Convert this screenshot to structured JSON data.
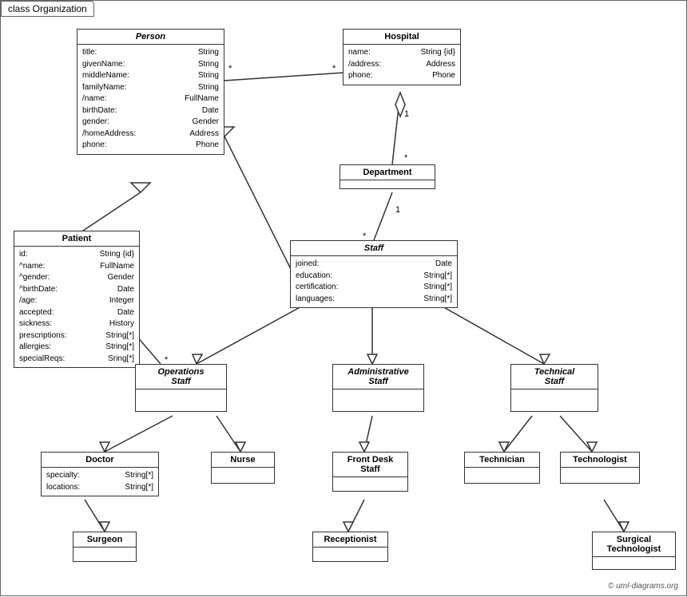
{
  "title": "class Organization",
  "classes": {
    "person": {
      "name": "Person",
      "italic": true,
      "attrs": [
        {
          "name": "title:",
          "type": "String"
        },
        {
          "name": "givenName:",
          "type": "String"
        },
        {
          "name": "middleName:",
          "type": "String"
        },
        {
          "name": "familyName:",
          "type": "String"
        },
        {
          "name": "/name:",
          "type": "FullName"
        },
        {
          "name": "birthDate:",
          "type": "Date"
        },
        {
          "name": "gender:",
          "type": "Gender"
        },
        {
          "name": "/homeAddress:",
          "type": "Address"
        },
        {
          "name": "phone:",
          "type": "Phone"
        }
      ]
    },
    "hospital": {
      "name": "Hospital",
      "italic": false,
      "attrs": [
        {
          "name": "name:",
          "type": "String {id}"
        },
        {
          "name": "/address:",
          "type": "Address"
        },
        {
          "name": "phone:",
          "type": "Phone"
        }
      ]
    },
    "department": {
      "name": "Department",
      "italic": false,
      "attrs": []
    },
    "staff": {
      "name": "Staff",
      "italic": true,
      "attrs": [
        {
          "name": "joined:",
          "type": "Date"
        },
        {
          "name": "education:",
          "type": "String[*]"
        },
        {
          "name": "certification:",
          "type": "String[*]"
        },
        {
          "name": "languages:",
          "type": "String[*]"
        }
      ]
    },
    "patient": {
      "name": "Patient",
      "italic": false,
      "attrs": [
        {
          "name": "id:",
          "type": "String {id}"
        },
        {
          "name": "^name:",
          "type": "FullName"
        },
        {
          "name": "^gender:",
          "type": "Gender"
        },
        {
          "name": "^birthDate:",
          "type": "Date"
        },
        {
          "name": "/age:",
          "type": "Integer"
        },
        {
          "name": "accepted:",
          "type": "Date"
        },
        {
          "name": "sickness:",
          "type": "History"
        },
        {
          "name": "prescriptions:",
          "type": "String[*]"
        },
        {
          "name": "allergies:",
          "type": "String[*]"
        },
        {
          "name": "specialReqs:",
          "type": "Sring[*]"
        }
      ]
    },
    "operationsStaff": {
      "name": "Operations\nStaff",
      "italic": true,
      "attrs": []
    },
    "administrativeStaff": {
      "name": "Administrative\nStaff",
      "italic": true,
      "attrs": []
    },
    "technicalStaff": {
      "name": "Technical\nStaff",
      "italic": true,
      "attrs": []
    },
    "doctor": {
      "name": "Doctor",
      "italic": false,
      "attrs": [
        {
          "name": "specialty:",
          "type": "String[*]"
        },
        {
          "name": "locations:",
          "type": "String[*]"
        }
      ]
    },
    "nurse": {
      "name": "Nurse",
      "italic": false,
      "attrs": []
    },
    "frontDeskStaff": {
      "name": "Front Desk\nStaff",
      "italic": false,
      "attrs": []
    },
    "technician": {
      "name": "Technician",
      "italic": false,
      "attrs": []
    },
    "technologist": {
      "name": "Technologist",
      "italic": false,
      "attrs": []
    },
    "surgeon": {
      "name": "Surgeon",
      "italic": false,
      "attrs": []
    },
    "receptionist": {
      "name": "Receptionist",
      "italic": false,
      "attrs": []
    },
    "surgicalTechnologist": {
      "name": "Surgical\nTechnologist",
      "italic": false,
      "attrs": []
    }
  },
  "copyright": "© uml-diagrams.org"
}
